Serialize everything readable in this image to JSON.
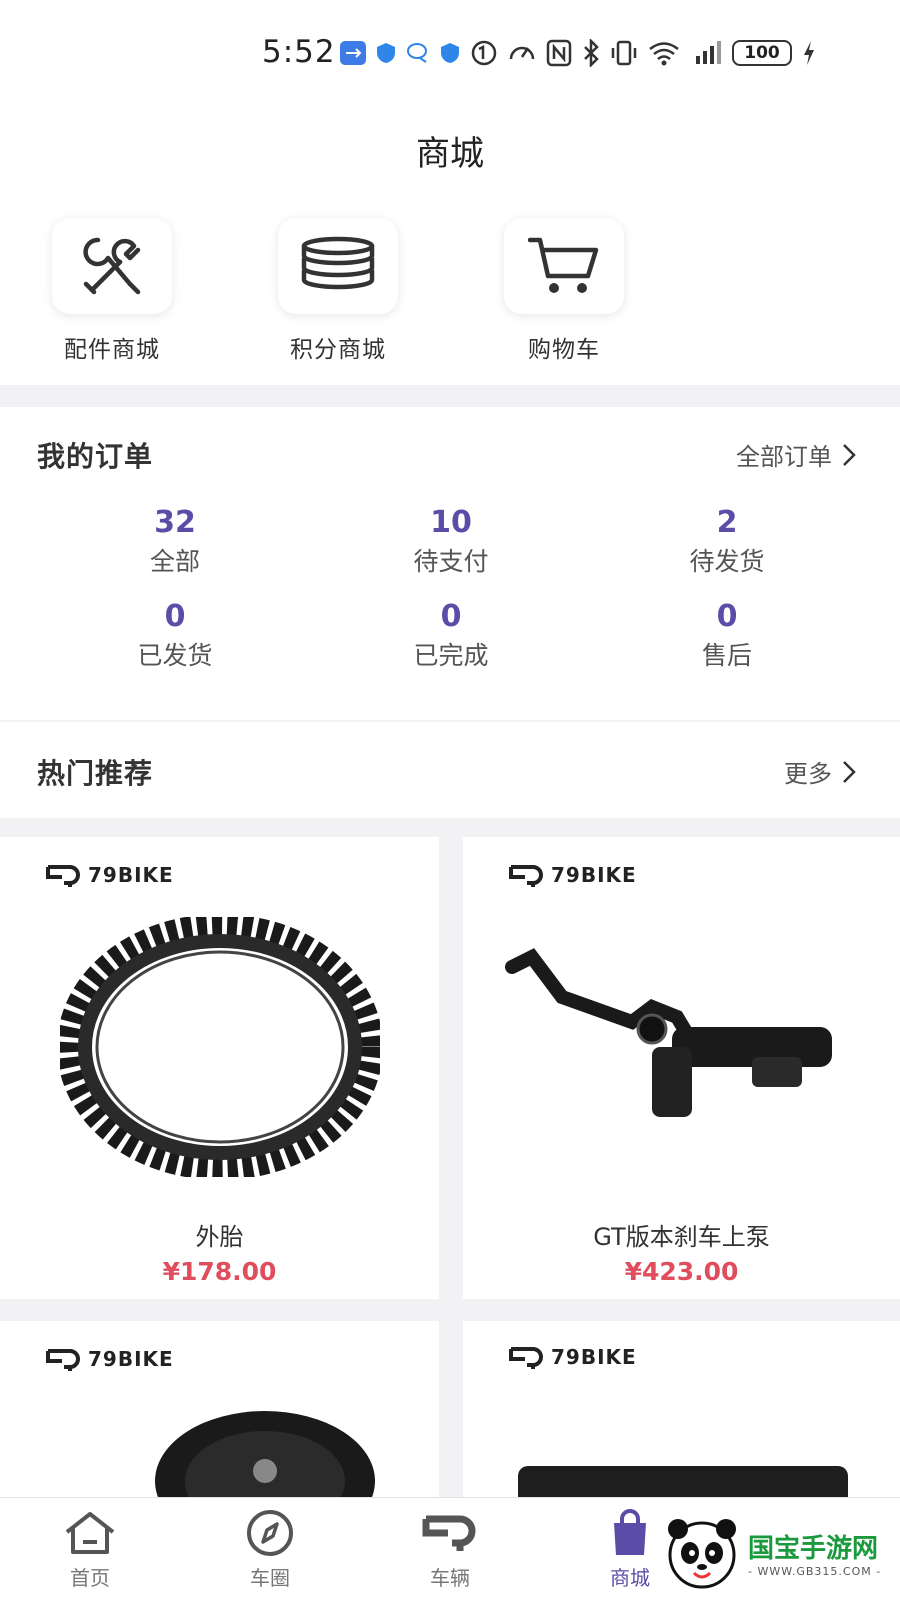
{
  "status": {
    "time": "5:52",
    "battery": "100"
  },
  "header": {
    "title": "商城"
  },
  "quick_links": [
    {
      "label": "配件商城",
      "icon": "tools-icon"
    },
    {
      "label": "积分商城",
      "icon": "coins-icon"
    },
    {
      "label": "购物车",
      "icon": "cart-icon"
    }
  ],
  "orders": {
    "title": "我的订单",
    "all_link": "全部订单",
    "stats": [
      {
        "value": "32",
        "label": "全部"
      },
      {
        "value": "10",
        "label": "待支付"
      },
      {
        "value": "2",
        "label": "待发货"
      },
      {
        "value": "0",
        "label": "已发货"
      },
      {
        "value": "0",
        "label": "已完成"
      },
      {
        "value": "0",
        "label": "售后"
      }
    ]
  },
  "hot": {
    "title": "热门推荐",
    "more_link": "更多"
  },
  "brand": "79BIKE",
  "products": [
    {
      "name": "外胎",
      "price": "¥178.00"
    },
    {
      "name": "GT版本刹车上泵",
      "price": "¥423.00"
    }
  ],
  "tabs": [
    {
      "label": "首页"
    },
    {
      "label": "车圈"
    },
    {
      "label": "车辆"
    },
    {
      "label": "商城"
    }
  ],
  "watermark": {
    "title": "国宝手游网",
    "url": "- WWW.GB315.COM -"
  },
  "colors": {
    "accent": "#5b4da7",
    "price": "#e04d5d"
  }
}
